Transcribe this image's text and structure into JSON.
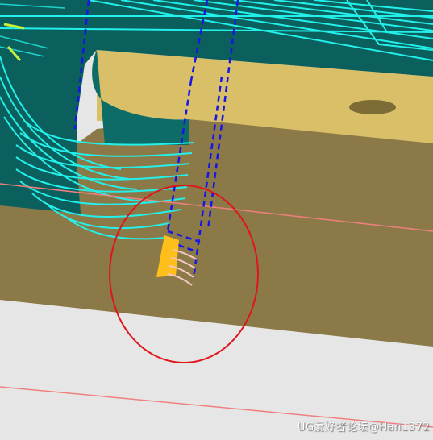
{
  "scene": {
    "colors": {
      "background": "#e6e6e6",
      "part_top_face": "#d8bf68",
      "part_side_face": "#8b7a47",
      "wall_dark_teal": "#0b5f5c",
      "toolpath_cyan": "#23f0ea",
      "tool_outline_blue": "#1515e8",
      "highlight_circle_red": "#e0141a",
      "tool_tip_orange": "#ffbf1a",
      "reference_line_pink": "#f08080"
    },
    "elements": {
      "toolpath_lines": "cyan-toolpath-lines",
      "cutting_tool": "end-mill-tool-preview",
      "highlight": "red-highlight-circle",
      "hole": "drilled-hole"
    }
  },
  "watermark": {
    "text": "UG爱好者论坛@Han1372"
  }
}
